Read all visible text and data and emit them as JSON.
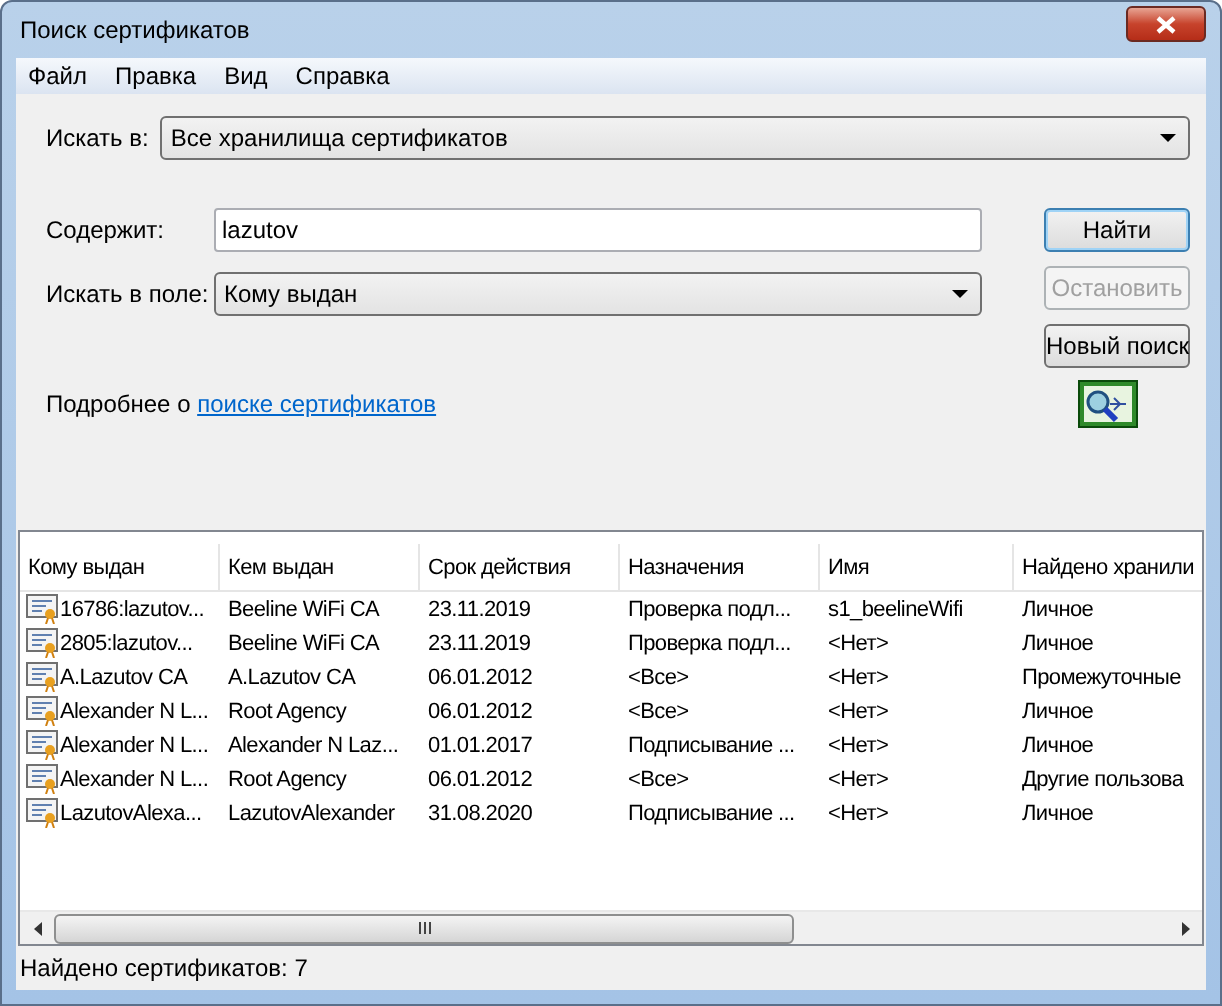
{
  "window": {
    "title": "Поиск сертификатов"
  },
  "menu": [
    "Файл",
    "Правка",
    "Вид",
    "Справка"
  ],
  "search_in": {
    "label": "Искать в:",
    "value": "Все хранилища сертификатов"
  },
  "contains": {
    "label": "Содержит:",
    "value": "lazutov"
  },
  "search_field": {
    "label": "Искать в поле:",
    "value": "Кому выдан"
  },
  "buttons": [
    {
      "label": "Найти",
      "default": true,
      "disabled": false
    },
    {
      "label": "Остановить",
      "default": false,
      "disabled": true
    },
    {
      "label": "Новый поиск",
      "default": false,
      "disabled": false
    }
  ],
  "info": {
    "text": "Подробнее о",
    "link": "поиске сертификатов"
  },
  "table": {
    "columns": [
      "Кому выдан",
      "Кем выдан",
      "Срок действия",
      "Назначения",
      "Имя",
      "Найдено хранили"
    ],
    "rows": [
      [
        "16786:lazutov...",
        "Beeline WiFi CA",
        "23.11.2019",
        "Проверка подл...",
        "s1_beelineWifi",
        "Личное"
      ],
      [
        "2805:lazutov...",
        "Beeline WiFi CA",
        "23.11.2019",
        "Проверка подл...",
        "<Нет>",
        "Личное"
      ],
      [
        "A.Lazutov CA",
        "A.Lazutov CA",
        "06.01.2012",
        "<Все>",
        "<Нет>",
        "Промежуточные"
      ],
      [
        "Alexander N L...",
        "Root Agency",
        "06.01.2012",
        "<Все>",
        "<Нет>",
        "Личное"
      ],
      [
        "Alexander N L...",
        "Alexander N Laz...",
        "01.01.2017",
        "Подписывание ...",
        "<Нет>",
        "Личное"
      ],
      [
        "Alexander N L...",
        "Root Agency",
        "06.01.2012",
        "<Все>",
        "<Нет>",
        "Другие пользова"
      ],
      [
        "LazutovAlexa...",
        "LazutovAlexander",
        "31.08.2020",
        "Подписывание ...",
        "<Нет>",
        "Личное"
      ]
    ]
  },
  "status_bar": "Найдено сертификатов: 7"
}
